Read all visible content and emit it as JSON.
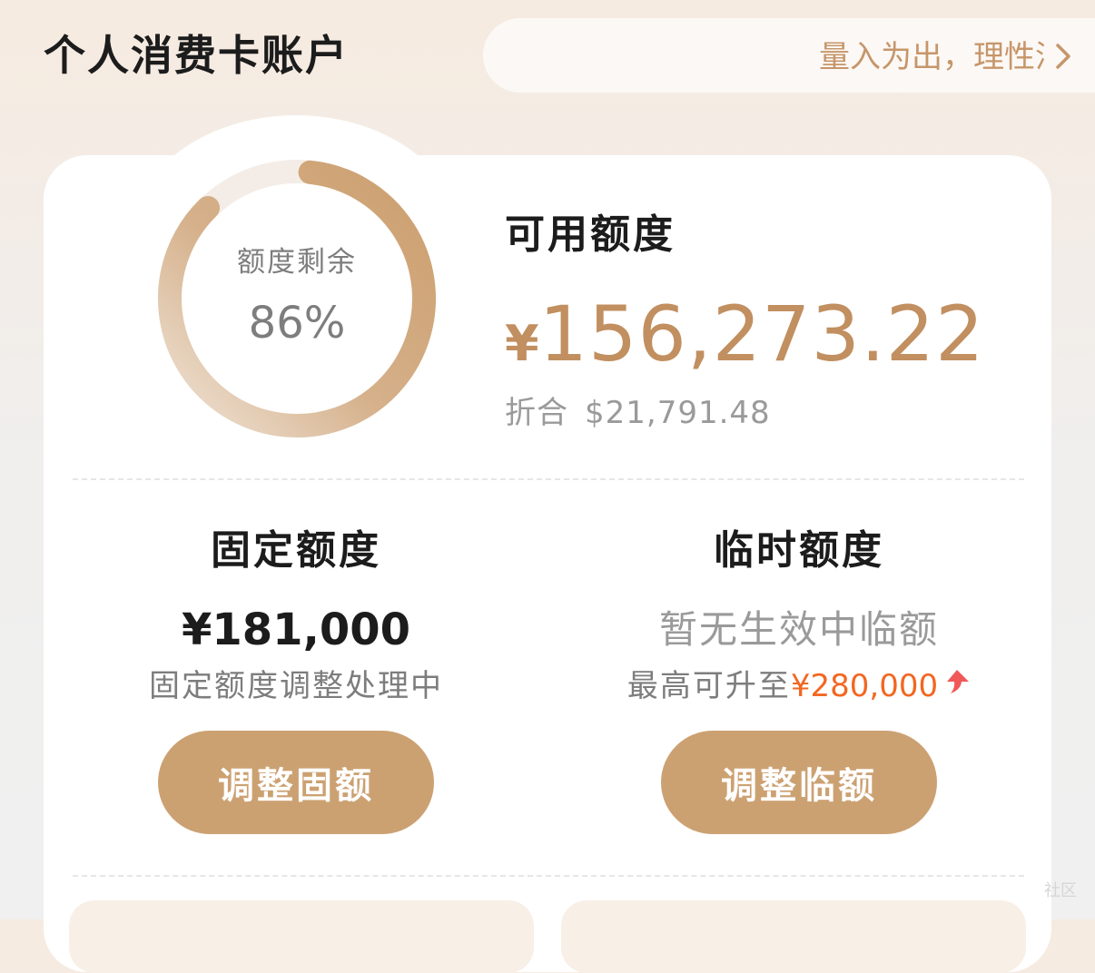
{
  "header": {
    "title": "个人消费卡账户",
    "slogan": "量入为出，理性消费",
    "slogan_arrow_icon": "chevron-right-icon"
  },
  "credit_ring": {
    "label": "额度剩余",
    "percent_text": "86%",
    "remaining_fraction": 0.86,
    "track_color": "#f4ede7",
    "fill_color_start": "#cc9f6e",
    "fill_color_end": "#eadbcc"
  },
  "available": {
    "title": "可用额度",
    "currency": "¥",
    "amount": "156,273.22",
    "convert_label": "折合",
    "convert_value": "$21,791.48"
  },
  "fixed": {
    "title": "固定额度",
    "amount": "¥181,000",
    "status": "固定额度调整处理中",
    "button_label": "调整固额"
  },
  "temporary": {
    "title": "临时额度",
    "status": "暂无生效中临额",
    "max_prefix": "最高可升至",
    "max_amount": "¥280,000",
    "raise_icon": "up-arrow-icon",
    "button_label": "调整临额"
  },
  "watermark": "社区",
  "colors": {
    "accent": "#c18f60",
    "button": "#cca172",
    "highlight": "#f26722"
  }
}
